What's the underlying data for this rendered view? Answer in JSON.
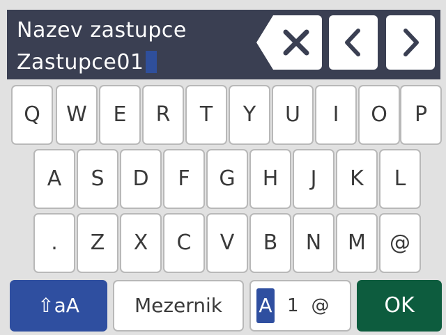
{
  "header": {
    "title": "Nazev zastupce",
    "value": "Zastupce01"
  },
  "keyboard": {
    "row1": [
      "Q",
      "W",
      "E",
      "R",
      "T",
      "Y",
      "U",
      "I",
      "O",
      "P"
    ],
    "row2": [
      "A",
      "S",
      "D",
      "F",
      "G",
      "H",
      "J",
      "K",
      "L"
    ],
    "row3": [
      ".",
      "Z",
      "X",
      "C",
      "V",
      "B",
      "N",
      "M",
      "@"
    ]
  },
  "bottom": {
    "shift_label": "⇧aA",
    "space_label": "Mezernik",
    "mode_letter": "A",
    "mode_number": "1",
    "mode_symbol": "@",
    "ok_label": "OK"
  },
  "colors": {
    "header_bg": "#3a3f52",
    "accent_blue": "#2f4fa0",
    "ok_green": "#0d5c3e"
  },
  "icons": {
    "backspace": "backspace-icon",
    "left": "chevron-left-icon",
    "right": "chevron-right-icon"
  }
}
